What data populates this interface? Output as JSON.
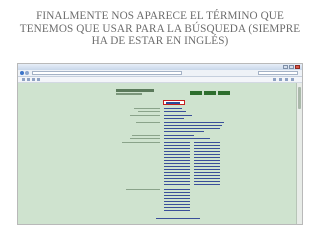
{
  "slide": {
    "title_lines": [
      "FINALMENTE NOS APARECE EL TÉRMINO QUE",
      "TENEMOS QUE USAR PARA LA BÚSQUEDA (SIEMPRE",
      "HA DE ESTAR EN INGLÉS)"
    ]
  },
  "colors": {
    "title_text": "#6b6b6b",
    "page_bg": "#cfe3cf",
    "highlight_border": "#c62020",
    "nav_button": "#2e6e2e"
  },
  "icons": {
    "back": "back-icon",
    "forward": "forward-icon",
    "close": "close-icon",
    "minimize": "minimize-icon",
    "maximize": "maximize-icon"
  }
}
